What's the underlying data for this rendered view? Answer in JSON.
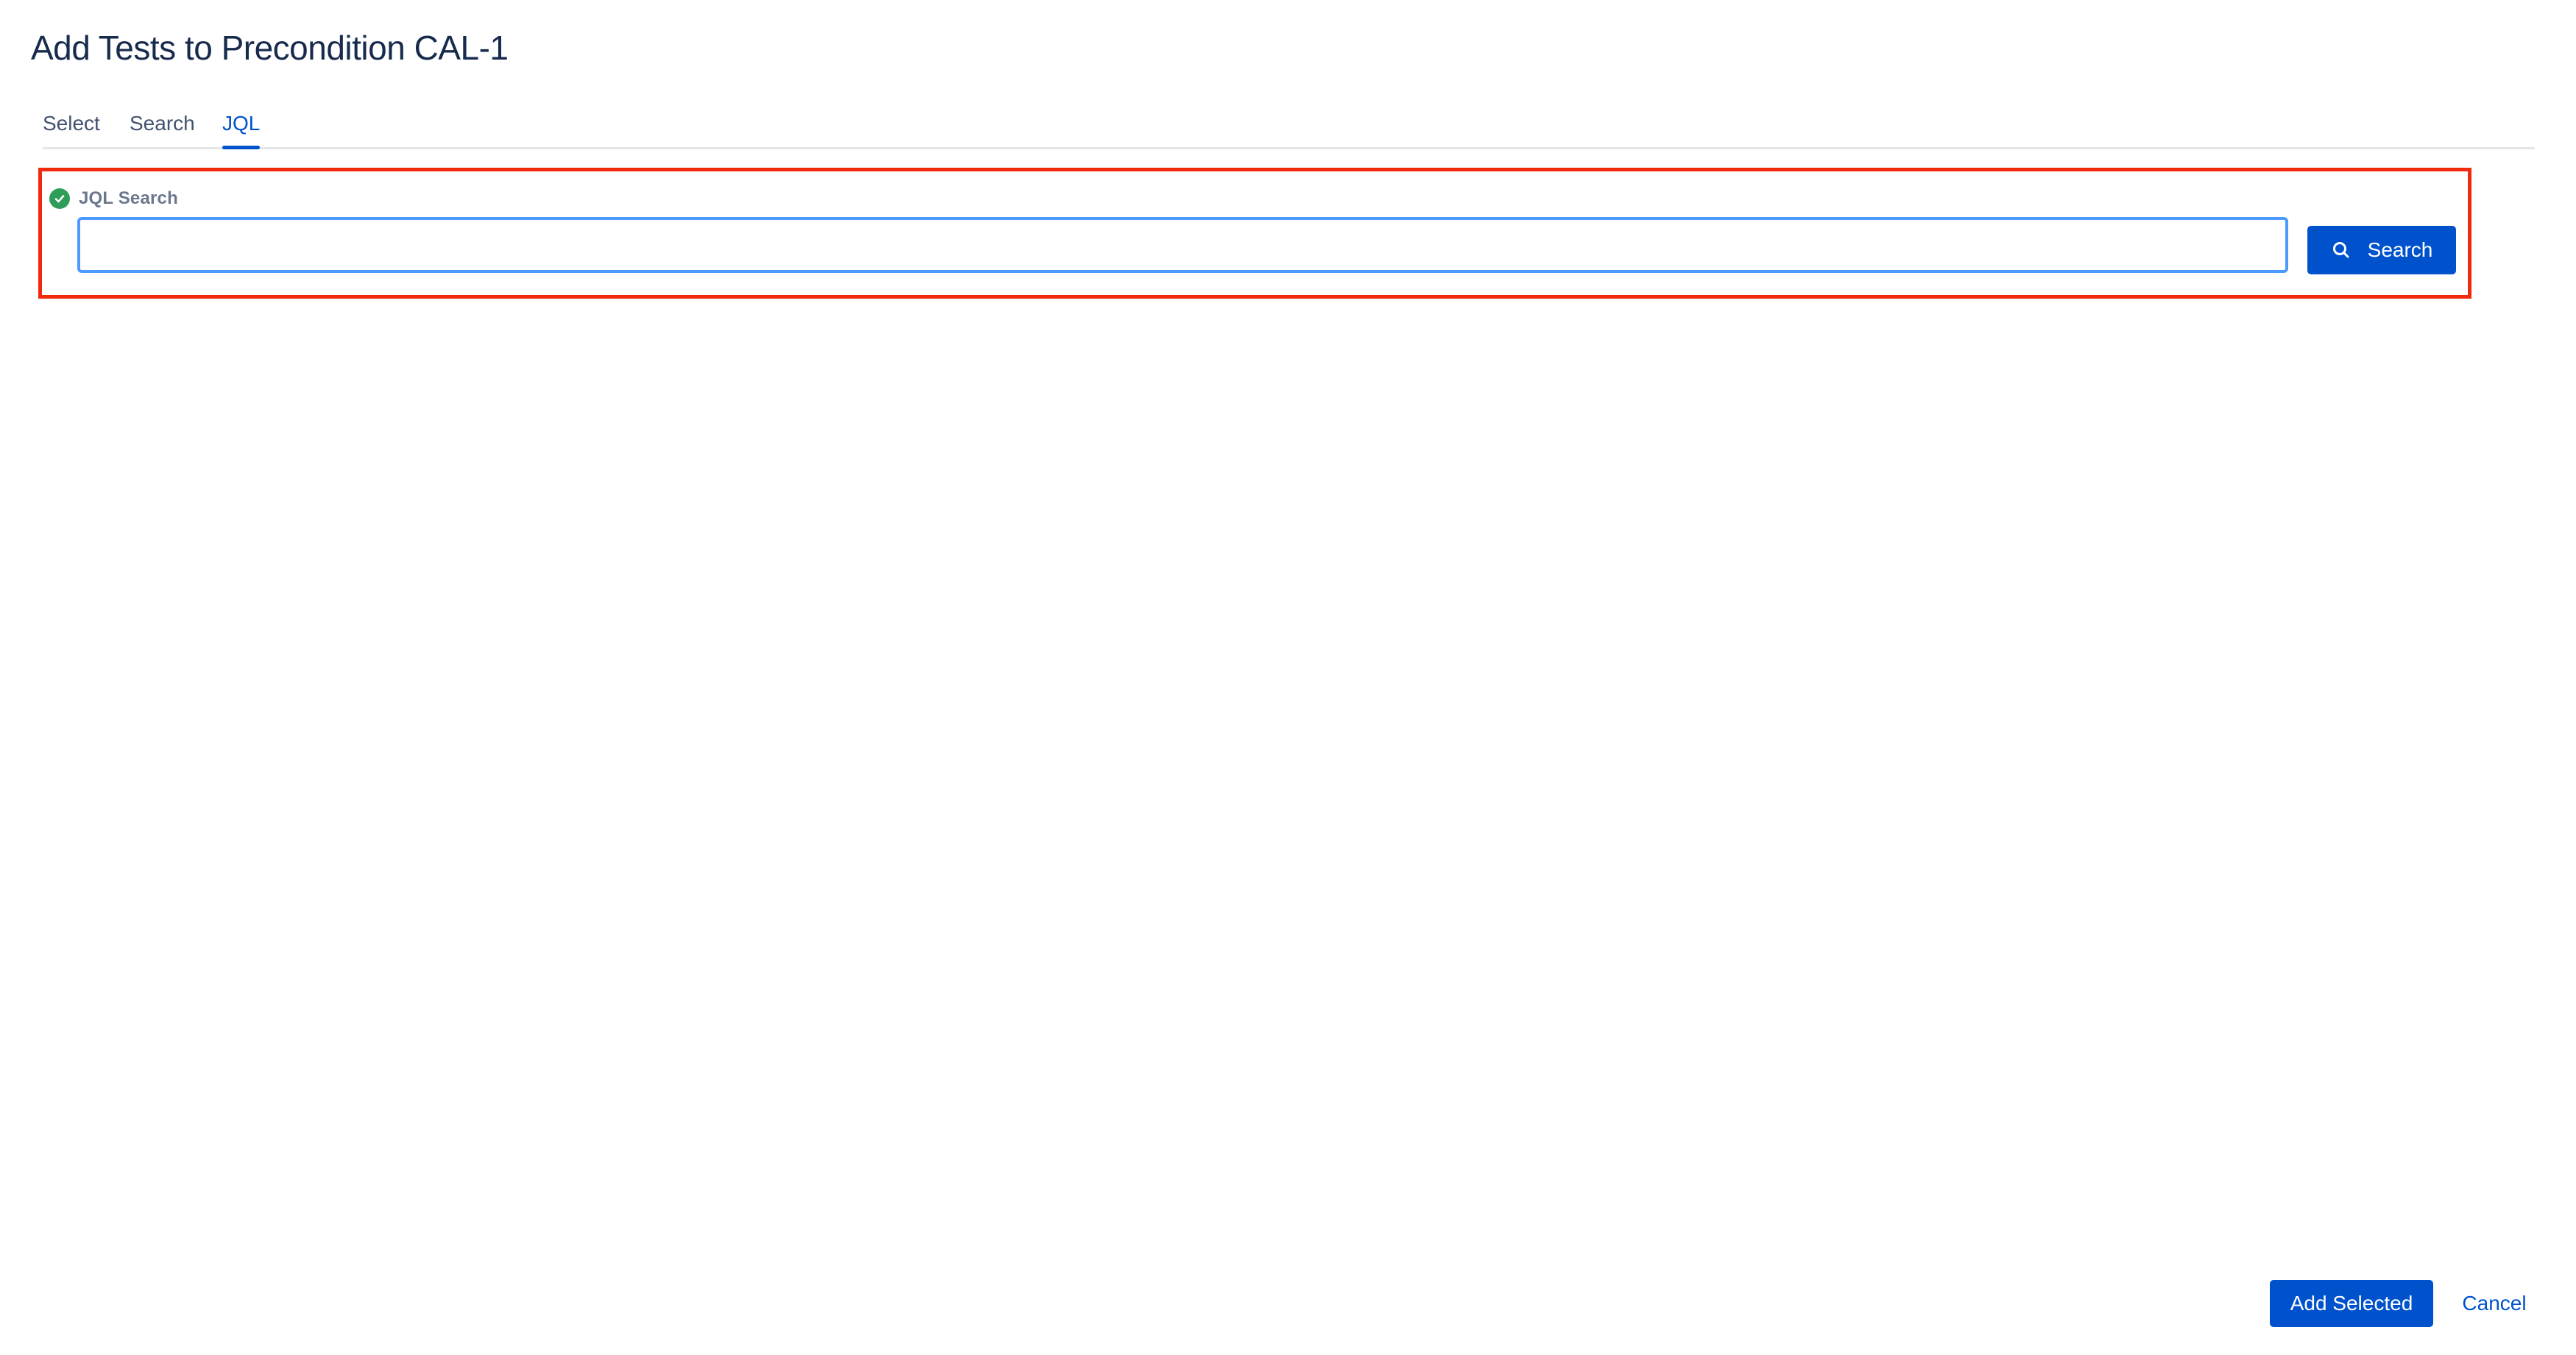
{
  "dialog": {
    "title": "Add Tests to Precondition CAL-1"
  },
  "tabs": [
    {
      "label": "Select",
      "active": false
    },
    {
      "label": "Search",
      "active": false
    },
    {
      "label": "JQL",
      "active": true
    }
  ],
  "jql": {
    "label": "JQL Search",
    "value": "",
    "placeholder": "",
    "status_icon": "check-circle-icon",
    "search_button_label": "Search",
    "search_icon": "search-icon"
  },
  "footer": {
    "add_selected_label": "Add Selected",
    "cancel_label": "Cancel"
  },
  "colors": {
    "primary": "#0052cc",
    "text": "#172b4d",
    "success": "#2e9d57",
    "focus_border": "#4c9aff",
    "highlight": "#f02a0c"
  }
}
